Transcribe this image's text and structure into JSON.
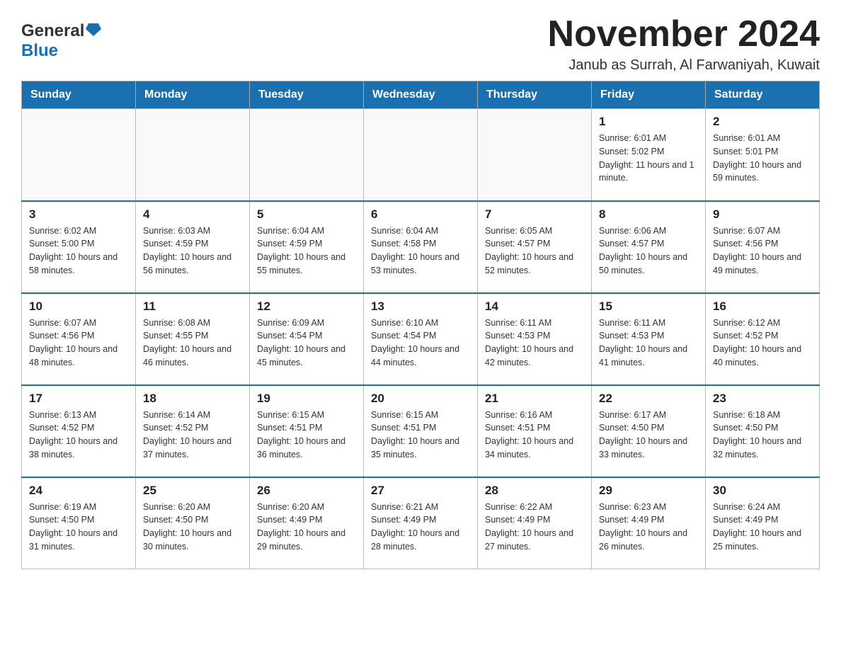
{
  "header": {
    "logo_general": "General",
    "logo_blue": "Blue",
    "month_title": "November 2024",
    "location": "Janub as Surrah, Al Farwaniyah, Kuwait"
  },
  "days_of_week": [
    "Sunday",
    "Monday",
    "Tuesday",
    "Wednesday",
    "Thursday",
    "Friday",
    "Saturday"
  ],
  "weeks": [
    {
      "days": [
        {
          "number": "",
          "info": ""
        },
        {
          "number": "",
          "info": ""
        },
        {
          "number": "",
          "info": ""
        },
        {
          "number": "",
          "info": ""
        },
        {
          "number": "",
          "info": ""
        },
        {
          "number": "1",
          "info": "Sunrise: 6:01 AM\nSunset: 5:02 PM\nDaylight: 11 hours and 1 minute."
        },
        {
          "number": "2",
          "info": "Sunrise: 6:01 AM\nSunset: 5:01 PM\nDaylight: 10 hours and 59 minutes."
        }
      ]
    },
    {
      "days": [
        {
          "number": "3",
          "info": "Sunrise: 6:02 AM\nSunset: 5:00 PM\nDaylight: 10 hours and 58 minutes."
        },
        {
          "number": "4",
          "info": "Sunrise: 6:03 AM\nSunset: 4:59 PM\nDaylight: 10 hours and 56 minutes."
        },
        {
          "number": "5",
          "info": "Sunrise: 6:04 AM\nSunset: 4:59 PM\nDaylight: 10 hours and 55 minutes."
        },
        {
          "number": "6",
          "info": "Sunrise: 6:04 AM\nSunset: 4:58 PM\nDaylight: 10 hours and 53 minutes."
        },
        {
          "number": "7",
          "info": "Sunrise: 6:05 AM\nSunset: 4:57 PM\nDaylight: 10 hours and 52 minutes."
        },
        {
          "number": "8",
          "info": "Sunrise: 6:06 AM\nSunset: 4:57 PM\nDaylight: 10 hours and 50 minutes."
        },
        {
          "number": "9",
          "info": "Sunrise: 6:07 AM\nSunset: 4:56 PM\nDaylight: 10 hours and 49 minutes."
        }
      ]
    },
    {
      "days": [
        {
          "number": "10",
          "info": "Sunrise: 6:07 AM\nSunset: 4:56 PM\nDaylight: 10 hours and 48 minutes."
        },
        {
          "number": "11",
          "info": "Sunrise: 6:08 AM\nSunset: 4:55 PM\nDaylight: 10 hours and 46 minutes."
        },
        {
          "number": "12",
          "info": "Sunrise: 6:09 AM\nSunset: 4:54 PM\nDaylight: 10 hours and 45 minutes."
        },
        {
          "number": "13",
          "info": "Sunrise: 6:10 AM\nSunset: 4:54 PM\nDaylight: 10 hours and 44 minutes."
        },
        {
          "number": "14",
          "info": "Sunrise: 6:11 AM\nSunset: 4:53 PM\nDaylight: 10 hours and 42 minutes."
        },
        {
          "number": "15",
          "info": "Sunrise: 6:11 AM\nSunset: 4:53 PM\nDaylight: 10 hours and 41 minutes."
        },
        {
          "number": "16",
          "info": "Sunrise: 6:12 AM\nSunset: 4:52 PM\nDaylight: 10 hours and 40 minutes."
        }
      ]
    },
    {
      "days": [
        {
          "number": "17",
          "info": "Sunrise: 6:13 AM\nSunset: 4:52 PM\nDaylight: 10 hours and 38 minutes."
        },
        {
          "number": "18",
          "info": "Sunrise: 6:14 AM\nSunset: 4:52 PM\nDaylight: 10 hours and 37 minutes."
        },
        {
          "number": "19",
          "info": "Sunrise: 6:15 AM\nSunset: 4:51 PM\nDaylight: 10 hours and 36 minutes."
        },
        {
          "number": "20",
          "info": "Sunrise: 6:15 AM\nSunset: 4:51 PM\nDaylight: 10 hours and 35 minutes."
        },
        {
          "number": "21",
          "info": "Sunrise: 6:16 AM\nSunset: 4:51 PM\nDaylight: 10 hours and 34 minutes."
        },
        {
          "number": "22",
          "info": "Sunrise: 6:17 AM\nSunset: 4:50 PM\nDaylight: 10 hours and 33 minutes."
        },
        {
          "number": "23",
          "info": "Sunrise: 6:18 AM\nSunset: 4:50 PM\nDaylight: 10 hours and 32 minutes."
        }
      ]
    },
    {
      "days": [
        {
          "number": "24",
          "info": "Sunrise: 6:19 AM\nSunset: 4:50 PM\nDaylight: 10 hours and 31 minutes."
        },
        {
          "number": "25",
          "info": "Sunrise: 6:20 AM\nSunset: 4:50 PM\nDaylight: 10 hours and 30 minutes."
        },
        {
          "number": "26",
          "info": "Sunrise: 6:20 AM\nSunset: 4:49 PM\nDaylight: 10 hours and 29 minutes."
        },
        {
          "number": "27",
          "info": "Sunrise: 6:21 AM\nSunset: 4:49 PM\nDaylight: 10 hours and 28 minutes."
        },
        {
          "number": "28",
          "info": "Sunrise: 6:22 AM\nSunset: 4:49 PM\nDaylight: 10 hours and 27 minutes."
        },
        {
          "number": "29",
          "info": "Sunrise: 6:23 AM\nSunset: 4:49 PM\nDaylight: 10 hours and 26 minutes."
        },
        {
          "number": "30",
          "info": "Sunrise: 6:24 AM\nSunset: 4:49 PM\nDaylight: 10 hours and 25 minutes."
        }
      ]
    }
  ]
}
